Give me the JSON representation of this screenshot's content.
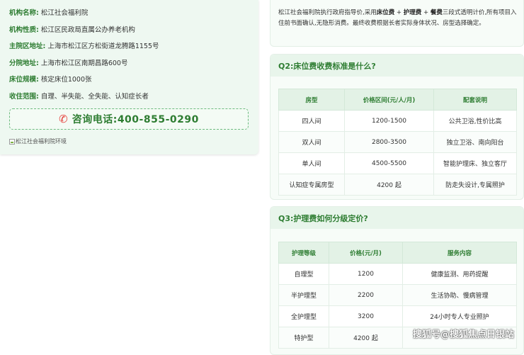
{
  "institution": {
    "rows": [
      {
        "label": "机构名称:",
        "value": "松江社会福利院"
      },
      {
        "label": "机构性质:",
        "value": "松江区民政局直属公办养老机构"
      },
      {
        "label": "主院区地址:",
        "value": "上海市松江区方松街道龙腾路1155号"
      },
      {
        "label": "分院地址:",
        "value": "上海市松江区南期昌路600号"
      },
      {
        "label": "床位规模:",
        "value": "核定床位1000张"
      },
      {
        "label": "收住范围:",
        "value": "自理、半失能、全失能、认知症长者"
      }
    ],
    "phone_label": "咨询电话:400-855-0290",
    "image_alt": "松江社会福利院环境"
  },
  "intro": {
    "part1": "松江社会福利院执行政府指导价,采用",
    "bold1": "床位费",
    "sep1": " + ",
    "bold2": "护理费",
    "sep2": " + ",
    "bold3": "餐费",
    "part2": "三段式透明计价,所有项目入住前书面确认,无隐形消费。最终收费根据长者实际身体状况、房型选择确定。"
  },
  "q2": {
    "title": "Q2:床位费收费标准是什么?",
    "headers": [
      "房型",
      "价格区间(元/人/月)",
      "配套说明"
    ],
    "rows": [
      [
        "四人间",
        "1200-1500",
        "公共卫浴,性价比高"
      ],
      [
        "双人间",
        "2800-3500",
        "独立卫浴、南向阳台"
      ],
      [
        "单人间",
        "4500-5500",
        "智能护理床、独立客厅"
      ],
      [
        "认知症专属房型",
        "4200 起",
        "防走失设计,专属照护"
      ]
    ]
  },
  "q3": {
    "title": "Q3:护理费如何分级定价?",
    "headers": [
      "护理等级",
      "价格(元/月)",
      "服务内容"
    ],
    "rows": [
      [
        "自理型",
        "1200",
        "健康监测、用药提醒"
      ],
      [
        "半护理型",
        "2200",
        "生活协助、慢病管理"
      ],
      [
        "全护理型",
        "3200",
        "24小时专人专业照护"
      ],
      [
        "特护型",
        "4200 起",
        ""
      ]
    ]
  },
  "watermark": "搜狐号@搜狐焦点日银站",
  "colors": {
    "accent": "#2e7d32",
    "panel_bg": "#f7fcf8",
    "header_bg": "#e8f5eb",
    "phone_icon": "#e53935"
  }
}
